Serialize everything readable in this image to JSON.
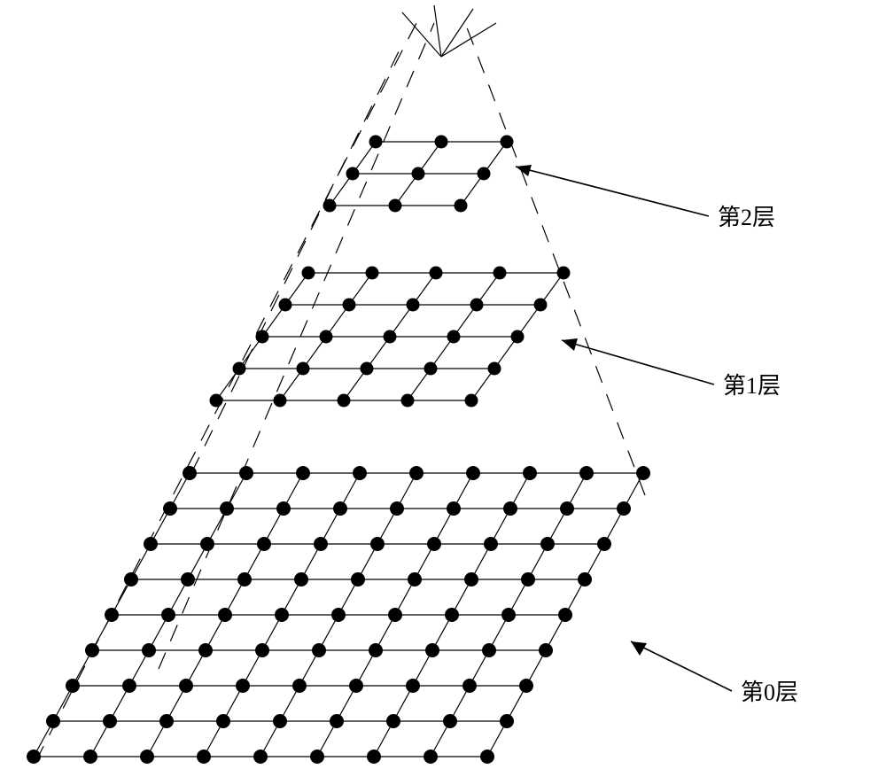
{
  "labels": {
    "layer2": "第2层",
    "layer1": "第1层",
    "layer0": "第0层"
  },
  "chart_data": {
    "type": "diagram",
    "title": "",
    "description": "Pyramid of three grid layers",
    "layers": [
      {
        "name": "第0层",
        "rows": 9,
        "cols": 9,
        "nodes": 81
      },
      {
        "name": "第1层",
        "rows": 5,
        "cols": 5,
        "nodes": 25
      },
      {
        "name": "第2层",
        "rows": 3,
        "cols": 3,
        "nodes": 9
      }
    ]
  }
}
